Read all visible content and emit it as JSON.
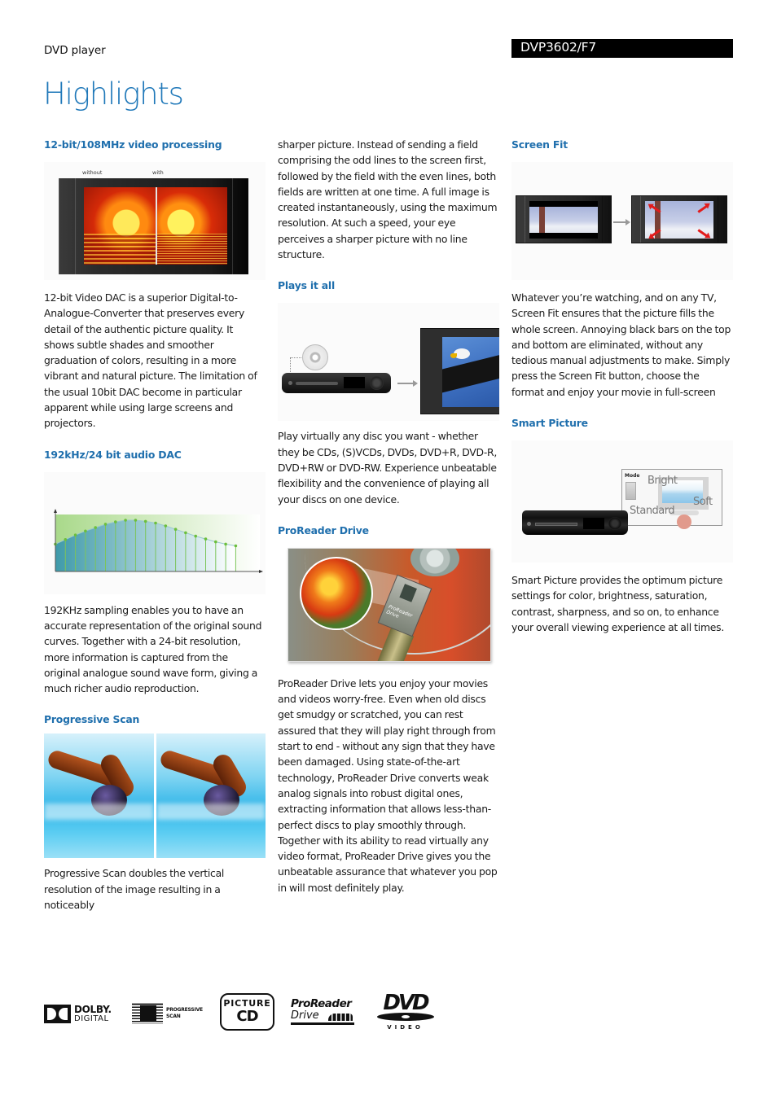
{
  "header": {
    "product_type": "DVD player",
    "model": "DVP3602/F7",
    "title": "Highlights"
  },
  "colors": {
    "heading_blue": "#1f6fad",
    "title_blue": "#1f78b9",
    "model_bar_bg": "#000000"
  },
  "sections": {
    "video_processing": {
      "heading": "12-bit/108MHz video processing",
      "figure_labels": {
        "left": "without",
        "right": "with"
      },
      "body": "12-bit Video DAC is a superior Digital-to-Analogue-Converter that preserves every detail of the authentic picture quality. It shows subtle shades and smoother graduation of colors, resulting in a more vibrant and natural picture. The limitation of the usual 10bit DAC become in particular apparent while using large screens and projectors."
    },
    "audio_dac": {
      "heading": "192kHz/24 bit audio DAC",
      "body": "192KHz sampling enables you to have an accurate representation of the original sound curves. Together with a 24-bit resolution, more information is captured from the original analogue sound wave form, giving a much richer audio reproduction."
    },
    "progressive_scan": {
      "heading": "Progressive Scan",
      "body_part1": "Progressive Scan doubles the vertical resolution of the image resulting in a noticeably",
      "body_part2": "sharper picture. Instead of sending a field comprising the odd lines to the screen first, followed by the field with the even lines, both fields are written at one time. A full image is created instantaneously, using the maximum resolution. At such a speed, your eye perceives a sharper picture with no line structure."
    },
    "plays_it_all": {
      "heading": "Plays it all",
      "body": "Play virtually any disc you want - whether they be CDs, (S)VCDs, DVDs, DVD+R, DVD-R, DVD+RW or DVD-RW. Experience unbeatable flexibility and the convenience of playing all your discs on one device."
    },
    "proreader": {
      "heading": "ProReader Drive",
      "chip_label": "ProReader Drive",
      "body": "ProReader Drive lets you enjoy your movies and videos worry-free. Even when old discs get smudgy or scratched, you can rest assured that they will play right through from start to end - without any sign that they have been damaged. Using state-of-the-art technology, ProReader Drive converts weak analog signals into robust digital ones, extracting information that allows less-than-perfect discs to play smoothly through. Together with its ability to read virtually any video format, ProReader Drive gives you the unbeatable assurance that whatever you pop in will most definitely play."
    },
    "screen_fit": {
      "heading": "Screen Fit",
      "body": "Whatever you’re watching, and on any TV, Screen Fit ensures that the picture fills the whole screen. Annoying black bars on the top and bottom are eliminated, without any tedious manual adjustments to make. Simply press the Screen Fit button, choose the format and enjoy your movie in full-screen"
    },
    "smart_picture": {
      "heading": "Smart Picture",
      "menu": {
        "title": "Mode",
        "options": [
          "Bright",
          "Soft",
          "Standard"
        ]
      },
      "body": "Smart Picture provides the optimum picture settings for color, brightness, saturation, contrast, sharpness, and so on, to enhance your overall viewing experience at all times."
    }
  },
  "audio_illustration": {
    "samples": [
      0.48,
      0.56,
      0.64,
      0.71,
      0.77,
      0.83,
      0.87,
      0.9,
      0.9,
      0.88,
      0.85,
      0.8,
      0.74,
      0.68,
      0.62,
      0.57,
      0.52,
      0.48,
      0.45
    ]
  },
  "logos": {
    "dolby": {
      "line1": "DOLBY.",
      "line2": "DIGITAL"
    },
    "progressive": {
      "line1": "PROGRESSIVE",
      "line2": "SCAN"
    },
    "picture_cd": {
      "line1": "PICTURE",
      "line2": "CD"
    },
    "proreader": {
      "line1": "ProReader",
      "line2": "Drive"
    },
    "dvd": {
      "line1": "DVD",
      "line2": "VIDEO"
    }
  }
}
